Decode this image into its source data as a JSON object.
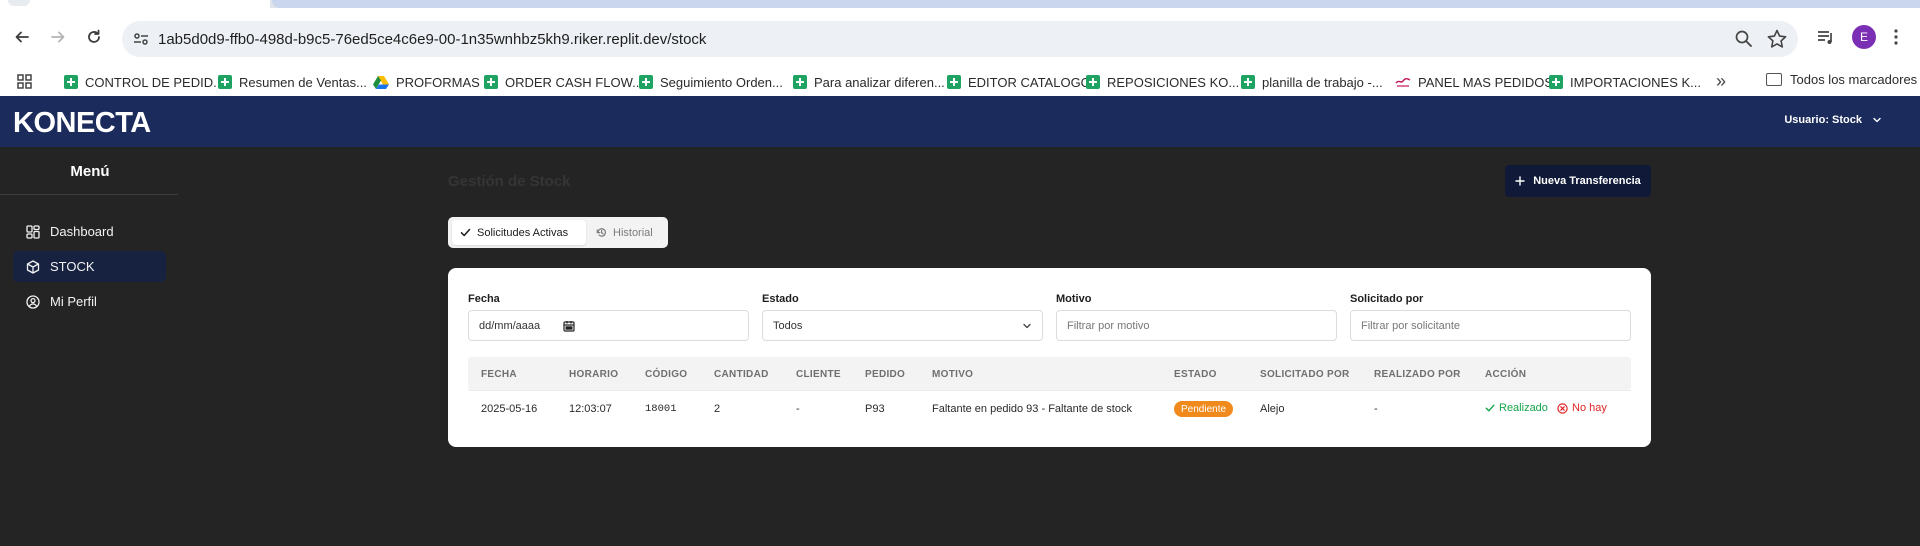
{
  "browser": {
    "url": "1ab5d0d9-ffb0-498d-b9c5-76ed5ce4c6e9-00-1n35wnhbz5kh9.riker.replit.dev/stock",
    "profile_initial": "E",
    "bookmarks": [
      {
        "label": "CONTROL DE PEDID...",
        "icon": "sheets-icon"
      },
      {
        "label": "Resumen de Ventas...",
        "icon": "sheets-icon"
      },
      {
        "label": "PROFORMAS",
        "icon": "drive-icon"
      },
      {
        "label": "ORDER CASH FLOW...",
        "icon": "sheets-icon"
      },
      {
        "label": "Seguimiento Orden...",
        "icon": "sheets-icon"
      },
      {
        "label": "Para analizar diferen...",
        "icon": "sheets-icon"
      },
      {
        "label": "EDITOR CATALOGO",
        "icon": "sheets-icon"
      },
      {
        "label": "REPOSICIONES KO...",
        "icon": "sheets-icon"
      },
      {
        "label": "planilla de trabajo -...",
        "icon": "sheets-icon"
      },
      {
        "label": "PANEL MAS PEDIDOS",
        "icon": "panel-icon"
      },
      {
        "label": "IMPORTACIONES K...",
        "icon": "sheets-icon"
      }
    ],
    "more_bookmarks": "»",
    "all_bookmarks": "Todos los marcadores"
  },
  "app": {
    "logo": "KONECTA",
    "user_label": "Usuario: Stock"
  },
  "sidebar": {
    "title": "Menú",
    "items": [
      {
        "label": "Dashboard",
        "icon": "grid-icon",
        "active": false
      },
      {
        "label": "STOCK",
        "icon": "box-icon",
        "active": true
      },
      {
        "label": "Mi Perfil",
        "icon": "user-circle-icon",
        "active": false
      }
    ]
  },
  "main": {
    "title": "Gestión de Stock",
    "new_transfer_label": "Nueva Transferencia",
    "tabs": [
      {
        "label": "Solicitudes Activas",
        "active": true
      },
      {
        "label": "Historial",
        "active": false
      }
    ],
    "filters": {
      "fecha_label": "Fecha",
      "fecha_value": "dd/mm/aaaa",
      "estado_label": "Estado",
      "estado_value": "Todos",
      "motivo_label": "Motivo",
      "motivo_placeholder": "Filtrar por motivo",
      "solicitado_label": "Solicitado por",
      "solicitado_placeholder": "Filtrar por solicitante"
    },
    "table": {
      "headers": [
        "FECHA",
        "HORARIO",
        "CÓDIGO",
        "CANTIDAD",
        "CLIENTE",
        "PEDIDO",
        "MOTIVO",
        "ESTADO",
        "SOLICITADO POR",
        "REALIZADO POR",
        "ACCIÓN"
      ],
      "rows": [
        {
          "fecha": "2025-05-16",
          "horario": "12:03:07",
          "codigo": "18001",
          "cantidad": "2",
          "cliente": "-",
          "pedido": "P93",
          "motivo": "Faltante en pedido 93 - Faltante de stock",
          "estado": "Pendiente",
          "solicitado_por": "Alejo",
          "realizado_por": "-",
          "accion_ok": "Realizado",
          "accion_no": "No hay"
        }
      ]
    }
  },
  "colors": {
    "header_bg": "#1b2b5c",
    "page_bg": "#242424",
    "active_nav": "#162240",
    "button_bg": "#101a38",
    "pending_badge": "#f08a1c",
    "ok_action": "#17a34a",
    "no_action": "#e02424"
  }
}
